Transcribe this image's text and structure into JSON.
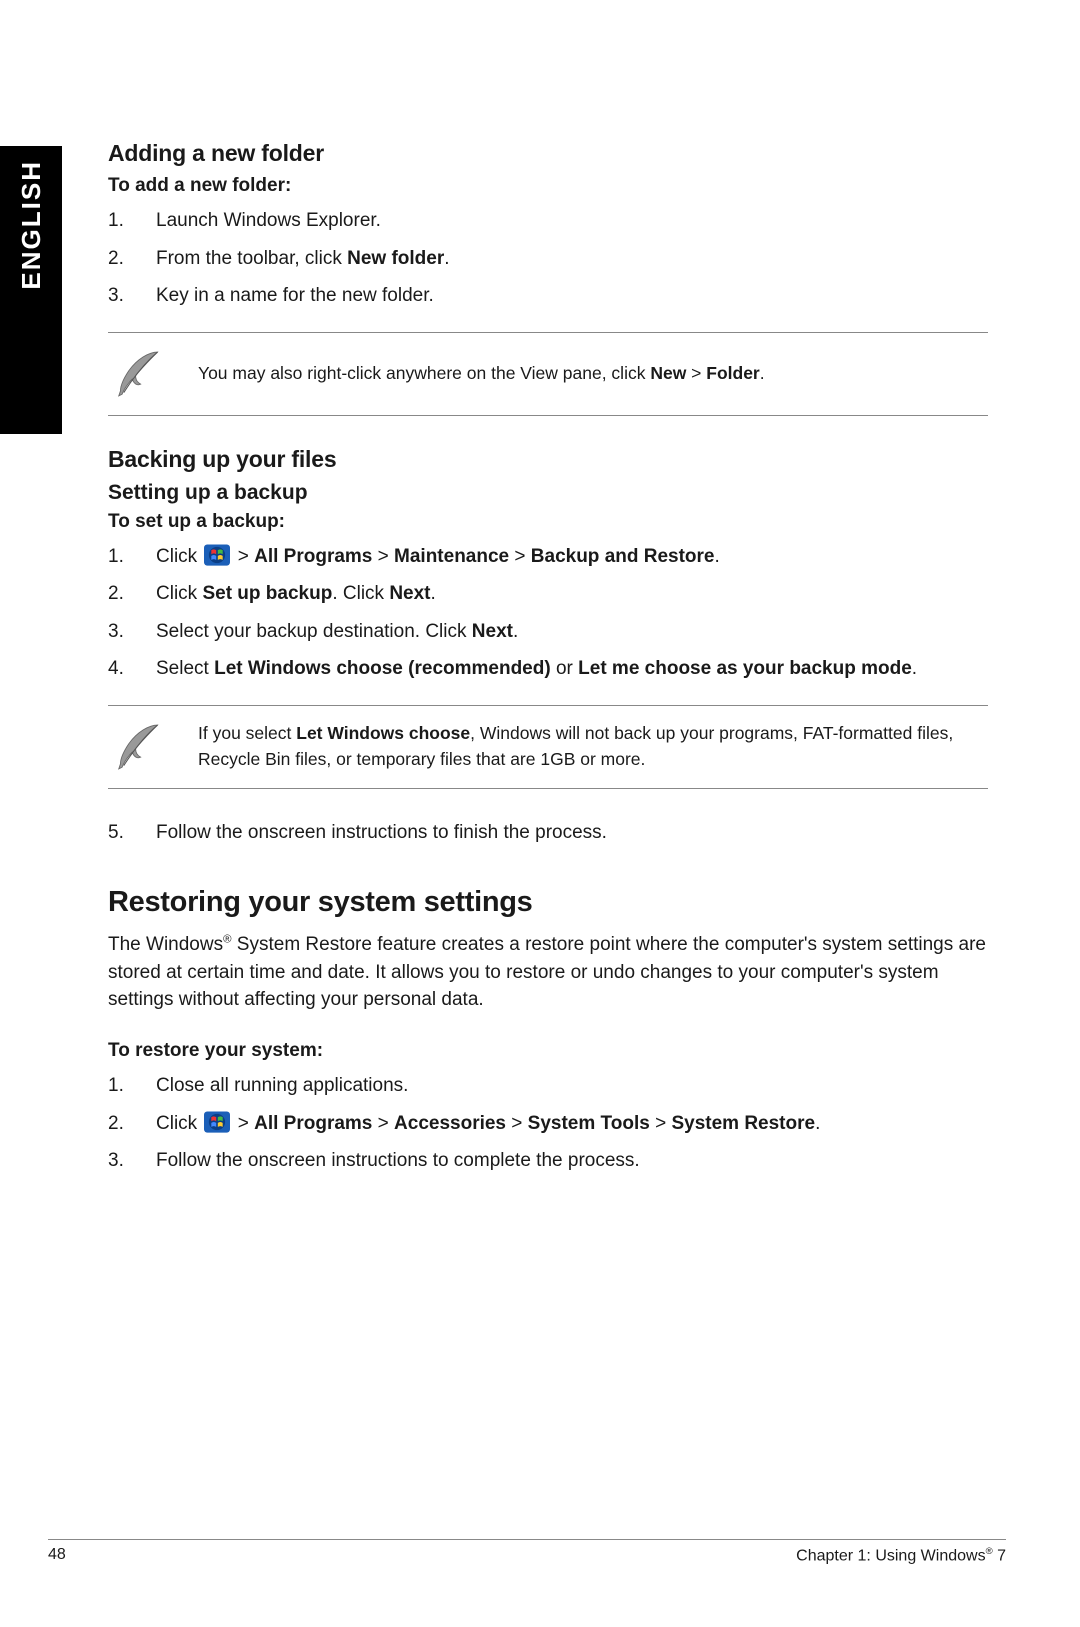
{
  "sidebar": {
    "language": "ENGLISH"
  },
  "section1": {
    "heading": "Adding a new folder",
    "instr": "To add a new folder:",
    "steps": [
      {
        "n": "1.",
        "text": "Launch Windows Explorer."
      },
      {
        "n": "2.",
        "pre": "From the toolbar, click ",
        "b1": "New folder",
        "post": "."
      },
      {
        "n": "3.",
        "text": "Key in a name for the new folder."
      }
    ],
    "note_pre": "You may also right-click anywhere on the View pane, click ",
    "note_b1": "New",
    "note_mid": " > ",
    "note_b2": "Folder",
    "note_post": "."
  },
  "section2": {
    "heading": "Backing up your files",
    "subheading": "Setting up a backup",
    "instr": "To set up a backup:",
    "steps": {
      "s1": {
        "n": "1.",
        "pre": "Click ",
        "gt1": " > ",
        "b1": "All Programs",
        "gt2": " > ",
        "b2": "Maintenance",
        "gt3": " > ",
        "b3": "Backup and Restore",
        "post": "."
      },
      "s2": {
        "n": "2.",
        "pre": "Click ",
        "b1": "Set up backup",
        "mid": ". Click ",
        "b2": "Next",
        "post": "."
      },
      "s3": {
        "n": "3.",
        "pre": "Select your backup destination. Click ",
        "b1": "Next",
        "post": "."
      },
      "s4": {
        "n": "4.",
        "pre": "Select ",
        "b1": "Let Windows choose (recommended)",
        "mid": " or ",
        "b2": "Let me choose as your backup mode",
        "post": "."
      },
      "s5": {
        "n": "5.",
        "text": "Follow the onscreen instructions to finish the process."
      }
    },
    "note_pre": "If you select ",
    "note_b1": "Let Windows choose",
    "note_post": ", Windows will not back up your programs, FAT-formatted files, Recycle Bin files, or temporary files that are 1GB or more."
  },
  "section3": {
    "heading": "Restoring your system settings",
    "intro_pre": "The Windows",
    "intro_reg": "®",
    "intro_post": " System Restore feature creates a restore point where the computer's system settings are stored at certain time and date. It allows you to restore or undo changes to your computer's system settings without affecting your personal data.",
    "instr": "To restore your system:",
    "steps": {
      "s1": {
        "n": "1.",
        "text": "Close all running applications."
      },
      "s2": {
        "n": "2.",
        "pre": "Click ",
        "gt1": " > ",
        "b1": "All Programs",
        "gt2": " > ",
        "b2": "Accessories",
        "gt3": " > ",
        "b3": "System Tools",
        "gt4": " > ",
        "b4": "System Restore",
        "post": "."
      },
      "s3": {
        "n": "3.",
        "text": "Follow the onscreen instructions to complete the process."
      }
    }
  },
  "footer": {
    "page": "48",
    "chapter_pre": "Chapter 1: Using Windows",
    "chapter_reg": "®",
    "chapter_post": " 7"
  }
}
